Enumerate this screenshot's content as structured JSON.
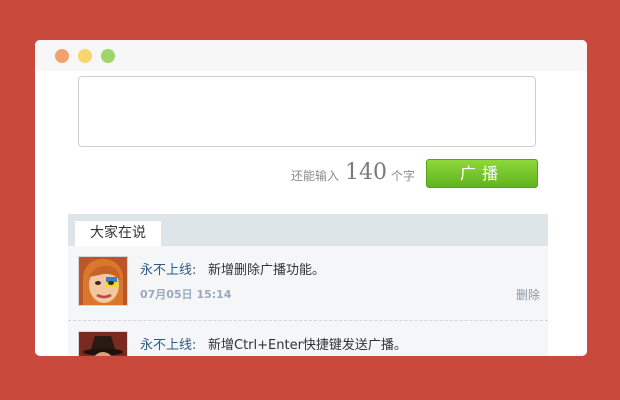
{
  "composer": {
    "text_value": "",
    "counter_prefix": "还能输入",
    "counter_number": "140",
    "counter_suffix": "个字",
    "broadcast_label": "广播"
  },
  "feed": {
    "tab_label": "大家在说",
    "items": [
      {
        "author": "永不上线:",
        "content": "新增删除广播功能。",
        "timestamp": "07月05日 15:14",
        "delete_label": "删除"
      },
      {
        "author": "永不上线:",
        "content": "新增Ctrl+Enter快捷键发送广播。"
      }
    ]
  },
  "colors": {
    "background": "#c94a3c",
    "button_green": "#7cc42b",
    "author_blue": "#2e5a88",
    "feed_header": "#dde5e9"
  }
}
